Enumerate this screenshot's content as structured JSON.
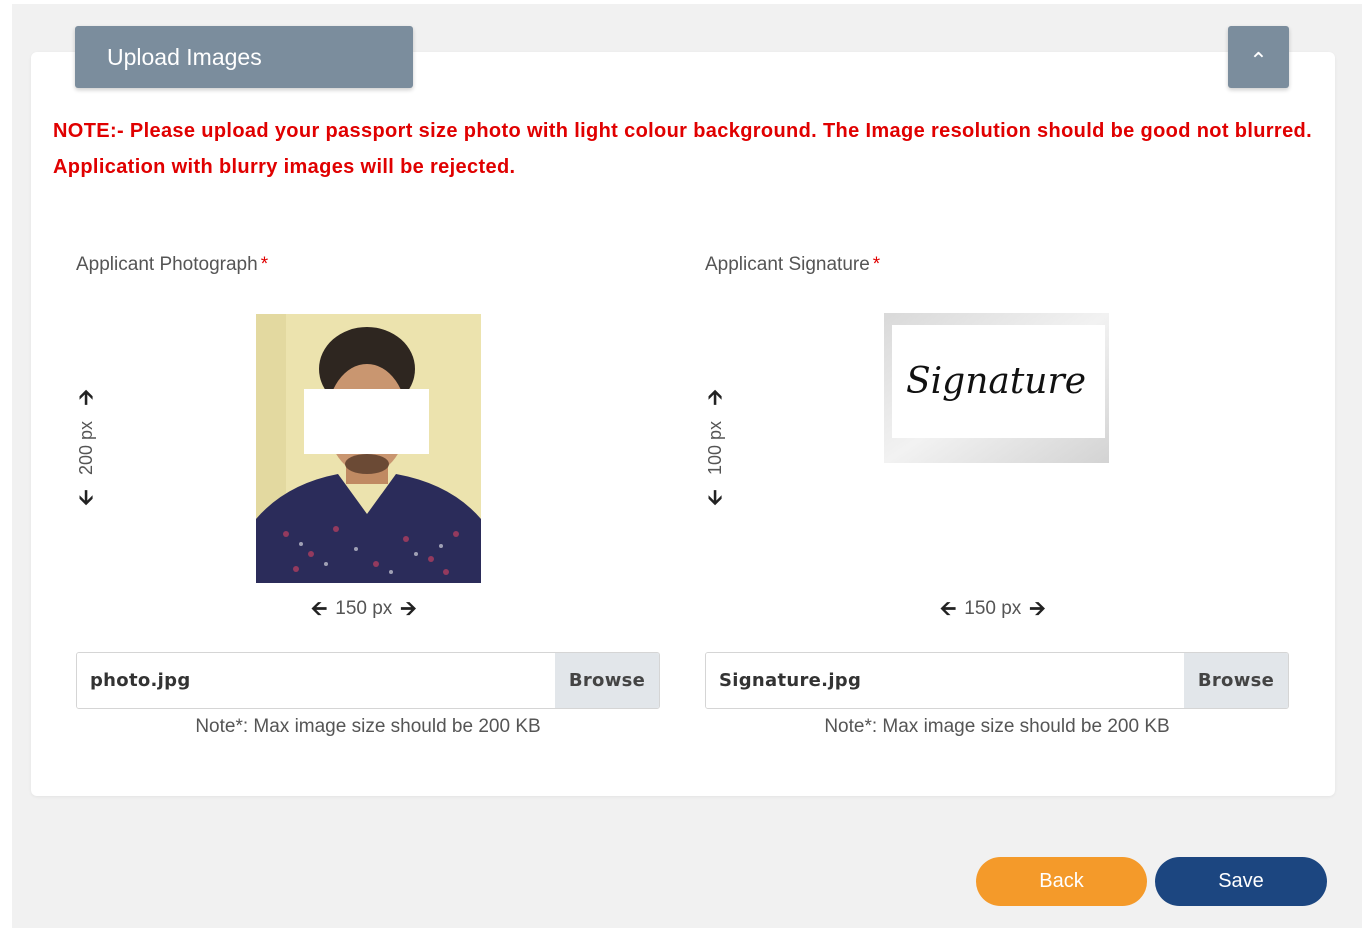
{
  "header": {
    "title": "Upload Images",
    "collapse_icon": "chevron-up-icon",
    "collapse_glyph": "⌃"
  },
  "note": "NOTE:- Please upload your passport size photo with light colour background. The Image resolution should be good not blurred. Application with blurry images will be rejected.",
  "photo": {
    "label": "Applicant Photograph",
    "required_mark": "*",
    "height_text": "200 px",
    "width_text": "150 px",
    "file_value": "photo.jpg",
    "browse_label": "Browse",
    "size_note": "Note*: Max image size should be 200 KB"
  },
  "signature": {
    "label": "Applicant Signature",
    "required_mark": "*",
    "height_text": "100 px",
    "width_text": "150 px",
    "file_value": "Signature.jpg",
    "browse_label": "Browse",
    "size_note": "Note*: Max image size should be 200 KB",
    "preview_text": "Signature"
  },
  "arrows": {
    "up": "🡩",
    "down": "🡫",
    "left": "🡨",
    "right": "🡪"
  },
  "actions": {
    "back_label": "Back",
    "save_label": "Save"
  },
  "colors": {
    "header_bg": "#7b8d9d",
    "note_red": "#e00000",
    "back_orange": "#f49a2a",
    "save_navy": "#1c4680"
  }
}
